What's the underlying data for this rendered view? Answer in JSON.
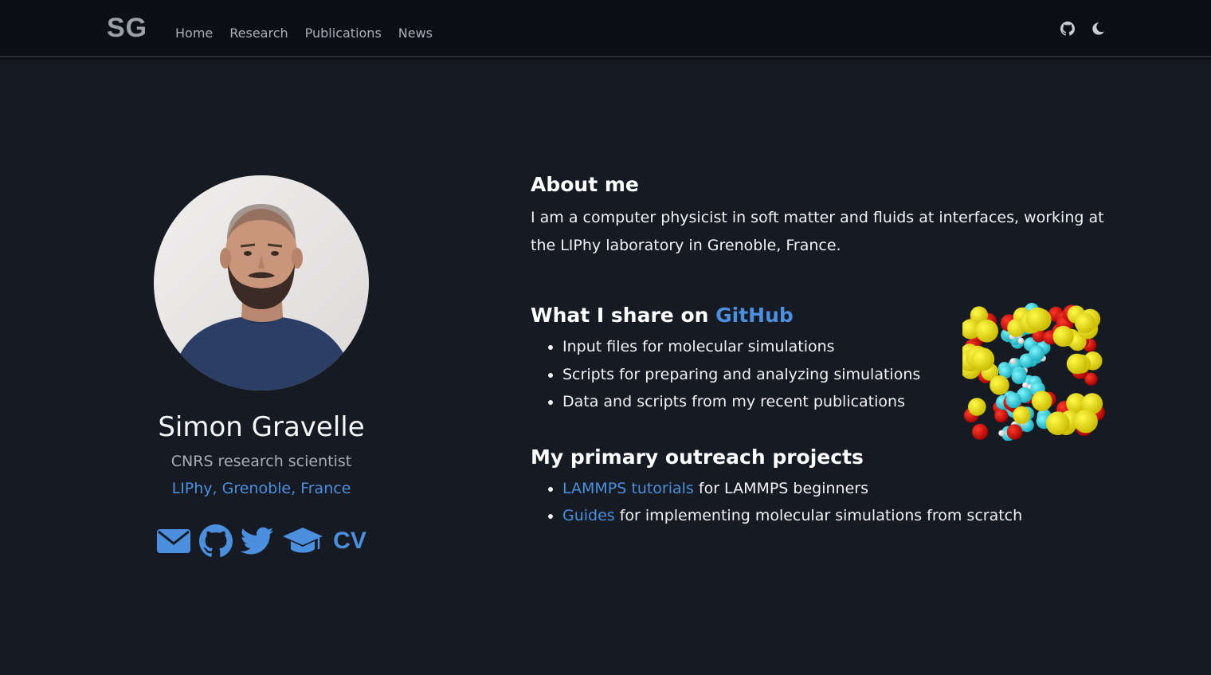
{
  "nav": {
    "brand": "SG",
    "links": [
      "Home",
      "Research",
      "Publications",
      "News"
    ],
    "icons": [
      "github-icon",
      "moon-icon"
    ]
  },
  "profile": {
    "name": "Simon Gravelle",
    "role": "CNRS research scientist",
    "affiliation": "LIPhy, Grenoble, France",
    "social_icons": [
      "envelope-icon",
      "github-icon",
      "twitter-icon",
      "graduation-cap-icon"
    ],
    "cv_label": "CV"
  },
  "about": {
    "title": "About me",
    "text": "I am a computer physicist in soft matter and fluids at interfaces, working at the LIPhy laboratory in Grenoble, France."
  },
  "share": {
    "title_prefix": "What I share on ",
    "title_link": "GitHub",
    "items": [
      "Input files for molecular simulations",
      "Scripts for preparing and analyzing simulations",
      "Data and scripts from my recent publications"
    ]
  },
  "outreach": {
    "title": "My primary outreach projects",
    "items": [
      {
        "link": "LAMMPS tutorials",
        "text": " for LAMMPS beginners"
      },
      {
        "link": "Guides",
        "text": " for implementing molecular simulations from scratch"
      }
    ]
  },
  "colors": {
    "background": "#161a22",
    "navbar": "#0c0f15",
    "accent": "#4c8fde",
    "muted": "#a8aeb6"
  }
}
